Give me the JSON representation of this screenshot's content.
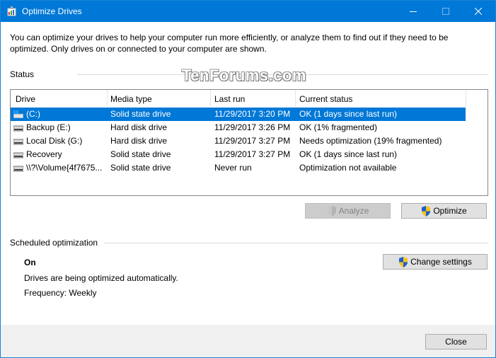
{
  "window": {
    "title": "Optimize Drives"
  },
  "intro_text": "You can optimize your drives to help your computer run more efficiently, or analyze them to find out if they need to be optimized. Only drives on or connected to your computer are shown.",
  "status": {
    "label": "Status",
    "watermark": "TenForums.com"
  },
  "table": {
    "columns": [
      "Drive",
      "Media type",
      "Last run",
      "Current status"
    ],
    "rows": [
      {
        "drive": "(C:)",
        "media": "Solid state drive",
        "last_run": "11/29/2017 3:20 PM",
        "status": "OK (1 days since last run)",
        "icon": "system-drive-icon",
        "selected": true
      },
      {
        "drive": "Backup (E:)",
        "media": "Hard disk drive",
        "last_run": "11/29/2017 3:26 PM",
        "status": "OK (1% fragmented)",
        "icon": "drive-icon",
        "selected": false
      },
      {
        "drive": "Local Disk (G:)",
        "media": "Hard disk drive",
        "last_run": "11/29/2017 3:27 PM",
        "status": "Needs optimization (19% fragmented)",
        "icon": "drive-icon",
        "selected": false
      },
      {
        "drive": "Recovery",
        "media": "Solid state drive",
        "last_run": "11/29/2017 3:27 PM",
        "status": "OK (1 days since last run)",
        "icon": "drive-icon",
        "selected": false
      },
      {
        "drive": "\\\\?\\Volume{4f7675...",
        "media": "Solid state drive",
        "last_run": "Never run",
        "status": "Optimization not available",
        "icon": "drive-icon",
        "selected": false
      }
    ]
  },
  "buttons": {
    "analyze": "Analyze",
    "optimize": "Optimize",
    "change_settings": "Change settings",
    "close": "Close"
  },
  "scheduled": {
    "label": "Scheduled optimization",
    "state": "On",
    "description": "Drives are being optimized automatically.",
    "frequency": "Frequency: Weekly"
  },
  "colors": {
    "titlebar": "#0078d7",
    "selection": "#0078d7",
    "footer": "#f0f0f0"
  }
}
